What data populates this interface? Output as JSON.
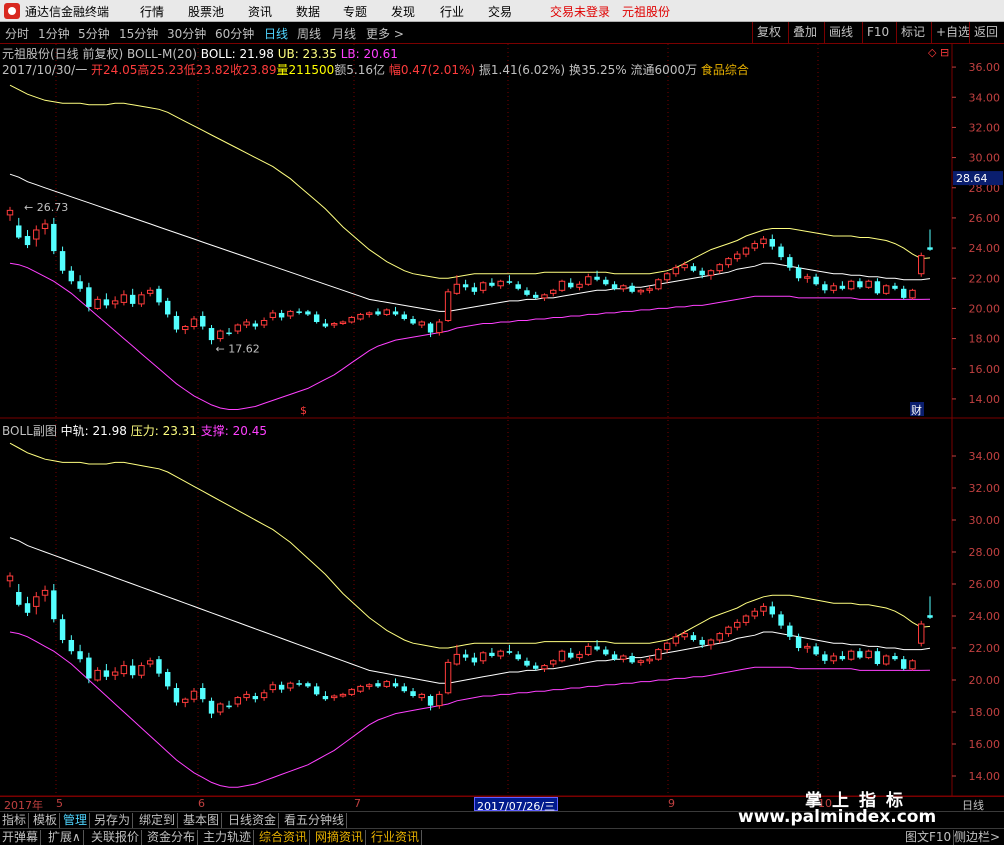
{
  "titlebar": {
    "app_title": "通达信金融终端",
    "menus": [
      "行情",
      "股票池",
      "资讯",
      "数据",
      "专题",
      "发现",
      "行业",
      "交易"
    ],
    "login_status": "交易未登录",
    "stock_name": "元祖股份"
  },
  "periodbar": {
    "tabs": [
      "分时",
      "1分钟",
      "5分钟",
      "15分钟",
      "30分钟",
      "60分钟",
      "日线",
      "周线",
      "月线",
      "更多 >"
    ],
    "active_tab": "日线",
    "tools": [
      "复权",
      "叠加",
      "画线",
      "F10",
      "标记",
      "+自选",
      "返回"
    ]
  },
  "main_panel": {
    "header": "元祖股份(日线 前复权)",
    "indicator": "BOLL-M(20)",
    "boll_label": "BOLL: 21.98",
    "ub_label": "UB: 23.35",
    "lb_label": "LB: 20.61",
    "date": "2017/10/30/一",
    "open": "开24.05",
    "high": "高25.23",
    "low": "低23.82",
    "close": "收23.89",
    "volume": "量211500",
    "amount": "额5.16亿",
    "change": "幅0.47(2.01%)",
    "amplitude": "振1.41(6.02%)",
    "turnover": "换35.25%",
    "float": "流通6000万",
    "sector": "食品综合",
    "high_marker": "26.73",
    "low_marker": "17.62",
    "price_tag": "28.64",
    "money_marker": "$",
    "fin_marker": "财",
    "corner_marker": "◇ ⊟"
  },
  "sub_panel": {
    "label": "BOLL副图",
    "mid": "中轨: 21.98",
    "upper": "压力: 23.31",
    "lower": "支撑: 20.45"
  },
  "axis": {
    "main_ticks": [
      "36.00",
      "34.00",
      "32.00",
      "30.00",
      "28.00",
      "26.00",
      "24.00",
      "22.00",
      "20.00",
      "18.00",
      "16.00",
      "14.00"
    ],
    "sub_ticks": [
      "34.00",
      "32.00",
      "30.00",
      "28.00",
      "26.00",
      "24.00",
      "22.00",
      "20.00",
      "18.00",
      "16.00",
      "14.00"
    ],
    "dates": [
      "2017年",
      "5",
      "6",
      "7",
      "9",
      "10"
    ],
    "cursor_date": "2017/07/26/三",
    "period_label": "日线"
  },
  "bottom_tabs_1": [
    "指标",
    "模板",
    "管理",
    "另存为",
    "绑定到",
    "基本图",
    "日线资金",
    "看五分钟线"
  ],
  "bottom_tabs_1_active": "管理",
  "bottom_tabs_2": [
    "开弹幕",
    "扩展∧",
    "关联报价",
    "资金分布",
    "主力轨迹",
    "综合资讯",
    "网摘资讯",
    "行业资讯"
  ],
  "bottom_right": [
    "图文F10",
    "侧边栏>"
  ],
  "watermark": {
    "cn": "掌上指标",
    "url": "www.palmindex.com"
  },
  "colors": {
    "up": "#ff3c3c",
    "down": "#54ffff",
    "mid_line": "#ffffff",
    "upper_line": "#ffff80",
    "lower_line": "#ff40ff",
    "grid_red": "#7a0000"
  },
  "chart_data": {
    "type": "candlestick",
    "ylim_main": [
      13.0,
      37.0
    ],
    "ylim_sub": [
      13.0,
      35.5
    ],
    "candles": [
      [
        26.2,
        26.73,
        25.8,
        26.5
      ],
      [
        25.5,
        26.0,
        24.6,
        24.7
      ],
      [
        24.8,
        25.2,
        24.0,
        24.2
      ],
      [
        24.6,
        25.5,
        24.1,
        25.2
      ],
      [
        25.3,
        25.9,
        24.9,
        25.6
      ],
      [
        25.6,
        26.0,
        23.6,
        23.8
      ],
      [
        23.8,
        24.1,
        22.3,
        22.5
      ],
      [
        22.5,
        22.8,
        21.6,
        21.8
      ],
      [
        21.8,
        22.2,
        21.1,
        21.3
      ],
      [
        21.4,
        21.7,
        19.8,
        20.1
      ],
      [
        20.0,
        20.8,
        19.9,
        20.6
      ],
      [
        20.6,
        21.0,
        20.0,
        20.2
      ],
      [
        20.3,
        20.8,
        20.0,
        20.5
      ],
      [
        20.4,
        21.2,
        20.2,
        20.9
      ],
      [
        20.9,
        21.3,
        20.1,
        20.3
      ],
      [
        20.3,
        21.1,
        20.1,
        20.9
      ],
      [
        21.0,
        21.4,
        20.8,
        21.2
      ],
      [
        21.3,
        21.5,
        20.2,
        20.4
      ],
      [
        20.5,
        20.7,
        19.4,
        19.6
      ],
      [
        19.5,
        19.8,
        18.4,
        18.6
      ],
      [
        18.6,
        18.9,
        18.3,
        18.8
      ],
      [
        18.8,
        19.5,
        18.6,
        19.3
      ],
      [
        19.5,
        19.8,
        18.6,
        18.8
      ],
      [
        18.7,
        18.9,
        17.62,
        17.9
      ],
      [
        18.0,
        18.6,
        17.8,
        18.5
      ],
      [
        18.4,
        18.7,
        18.2,
        18.3
      ],
      [
        18.5,
        19.0,
        18.3,
        18.9
      ],
      [
        18.9,
        19.3,
        18.7,
        19.1
      ],
      [
        19.0,
        19.2,
        18.6,
        18.8
      ],
      [
        18.9,
        19.4,
        18.7,
        19.2
      ],
      [
        19.4,
        19.9,
        19.2,
        19.7
      ],
      [
        19.7,
        19.9,
        19.2,
        19.4
      ],
      [
        19.5,
        19.9,
        19.3,
        19.8
      ],
      [
        19.8,
        20.0,
        19.6,
        19.7
      ],
      [
        19.8,
        19.9,
        19.5,
        19.6
      ],
      [
        19.6,
        19.8,
        19.0,
        19.1
      ],
      [
        19.0,
        19.3,
        18.7,
        18.8
      ],
      [
        18.9,
        19.1,
        18.7,
        19.0
      ],
      [
        19.0,
        19.2,
        18.9,
        19.1
      ],
      [
        19.1,
        19.5,
        19.0,
        19.4
      ],
      [
        19.3,
        19.7,
        19.2,
        19.6
      ],
      [
        19.6,
        19.8,
        19.4,
        19.7
      ],
      [
        19.8,
        20.0,
        19.5,
        19.6
      ],
      [
        19.6,
        20.0,
        19.5,
        19.9
      ],
      [
        19.8,
        20.1,
        19.5,
        19.6
      ],
      [
        19.6,
        19.8,
        19.2,
        19.3
      ],
      [
        19.3,
        19.5,
        18.9,
        19.0
      ],
      [
        18.9,
        19.2,
        18.7,
        19.1
      ],
      [
        19.0,
        19.1,
        18.1,
        18.4
      ],
      [
        18.4,
        19.3,
        18.2,
        19.1
      ],
      [
        19.2,
        21.3,
        19.1,
        21.1
      ],
      [
        21.0,
        22.2,
        20.9,
        21.6
      ],
      [
        21.6,
        21.9,
        21.2,
        21.4
      ],
      [
        21.4,
        21.7,
        20.9,
        21.1
      ],
      [
        21.2,
        21.8,
        21.0,
        21.7
      ],
      [
        21.7,
        22.0,
        21.4,
        21.5
      ],
      [
        21.5,
        21.9,
        21.3,
        21.8
      ],
      [
        21.8,
        22.2,
        21.6,
        21.7
      ],
      [
        21.6,
        21.8,
        21.2,
        21.3
      ],
      [
        21.2,
        21.4,
        20.8,
        20.9
      ],
      [
        20.9,
        21.1,
        20.6,
        20.7
      ],
      [
        20.7,
        21.0,
        20.5,
        20.9
      ],
      [
        21.0,
        21.3,
        20.8,
        21.2
      ],
      [
        21.2,
        21.9,
        21.1,
        21.8
      ],
      [
        21.7,
        22.0,
        21.3,
        21.4
      ],
      [
        21.4,
        21.8,
        21.2,
        21.6
      ],
      [
        21.6,
        22.3,
        21.5,
        22.1
      ],
      [
        22.1,
        22.5,
        21.8,
        21.9
      ],
      [
        21.9,
        22.1,
        21.5,
        21.6
      ],
      [
        21.6,
        21.8,
        21.2,
        21.3
      ],
      [
        21.3,
        21.6,
        21.1,
        21.5
      ],
      [
        21.5,
        21.7,
        21.0,
        21.1
      ],
      [
        21.1,
        21.3,
        20.9,
        21.2
      ],
      [
        21.2,
        21.5,
        21.0,
        21.3
      ],
      [
        21.3,
        22.0,
        21.2,
        21.9
      ],
      [
        21.9,
        22.4,
        21.7,
        22.3
      ],
      [
        22.3,
        22.9,
        22.1,
        22.7
      ],
      [
        22.7,
        23.1,
        22.5,
        22.9
      ],
      [
        22.8,
        23.0,
        22.4,
        22.5
      ],
      [
        22.5,
        22.7,
        22.0,
        22.2
      ],
      [
        22.2,
        22.6,
        21.9,
        22.5
      ],
      [
        22.5,
        23.0,
        22.3,
        22.9
      ],
      [
        22.9,
        23.4,
        22.7,
        23.3
      ],
      [
        23.3,
        23.8,
        23.1,
        23.6
      ],
      [
        23.6,
        24.1,
        23.4,
        24.0
      ],
      [
        24.0,
        24.5,
        23.8,
        24.3
      ],
      [
        24.3,
        24.8,
        24.0,
        24.6
      ],
      [
        24.6,
        24.9,
        23.9,
        24.1
      ],
      [
        24.1,
        24.3,
        23.2,
        23.4
      ],
      [
        23.4,
        23.6,
        22.5,
        22.7
      ],
      [
        22.7,
        22.9,
        21.8,
        22.0
      ],
      [
        22.0,
        22.3,
        21.7,
        22.1
      ],
      [
        22.1,
        22.3,
        21.5,
        21.6
      ],
      [
        21.6,
        21.8,
        21.0,
        21.2
      ],
      [
        21.2,
        21.7,
        21.0,
        21.5
      ],
      [
        21.5,
        21.8,
        21.2,
        21.3
      ],
      [
        21.3,
        21.9,
        21.2,
        21.8
      ],
      [
        21.8,
        22.0,
        21.3,
        21.4
      ],
      [
        21.4,
        21.9,
        21.3,
        21.8
      ],
      [
        21.8,
        22.0,
        20.9,
        21.0
      ],
      [
        21.0,
        21.6,
        20.9,
        21.5
      ],
      [
        21.5,
        21.7,
        21.2,
        21.3
      ],
      [
        21.3,
        21.5,
        20.6,
        20.7
      ],
      [
        20.7,
        21.3,
        20.6,
        21.2
      ],
      [
        22.3,
        23.7,
        22.1,
        23.5
      ],
      [
        24.05,
        25.23,
        23.82,
        23.89
      ]
    ],
    "upper": [
      34.8,
      34.5,
      34.2,
      34.0,
      33.8,
      33.7,
      33.6,
      33.6,
      33.6,
      33.5,
      33.5,
      33.5,
      33.6,
      33.6,
      33.5,
      33.4,
      33.3,
      33.2,
      33.0,
      32.7,
      32.4,
      32.1,
      31.8,
      31.5,
      31.2,
      30.9,
      30.6,
      30.3,
      30.0,
      29.7,
      29.4,
      29.0,
      28.6,
      28.1,
      27.6,
      27.1,
      26.6,
      26.0,
      25.4,
      24.9,
      24.4,
      23.9,
      23.5,
      23.1,
      22.8,
      22.5,
      22.3,
      22.2,
      22.1,
      22.0,
      22.0,
      22.1,
      22.2,
      22.3,
      22.3,
      22.3,
      22.3,
      22.3,
      22.3,
      22.3,
      22.3,
      22.4,
      22.4,
      22.4,
      22.4,
      22.4,
      22.4,
      22.4,
      22.4,
      22.3,
      22.3,
      22.3,
      22.3,
      22.3,
      22.4,
      22.5,
      22.7,
      23.0,
      23.3,
      23.6,
      23.9,
      24.1,
      24.3,
      24.5,
      24.8,
      25.0,
      25.2,
      25.3,
      25.3,
      25.3,
      25.2,
      25.1,
      25.0,
      24.9,
      24.8,
      24.8,
      24.8,
      24.7,
      24.7,
      24.6,
      24.5,
      24.3,
      24.0,
      23.6,
      23.3,
      23.35
    ],
    "mid": [
      28.9,
      28.7,
      28.4,
      28.2,
      28.0,
      27.8,
      27.6,
      27.4,
      27.2,
      27.0,
      26.8,
      26.6,
      26.4,
      26.2,
      26.0,
      25.8,
      25.6,
      25.4,
      25.2,
      25.0,
      24.8,
      24.6,
      24.4,
      24.2,
      24.0,
      23.8,
      23.6,
      23.4,
      23.2,
      23.0,
      22.8,
      22.6,
      22.4,
      22.2,
      22.0,
      21.8,
      21.6,
      21.4,
      21.2,
      21.0,
      20.8,
      20.6,
      20.5,
      20.4,
      20.3,
      20.2,
      20.1,
      20.0,
      19.9,
      19.8,
      19.8,
      19.9,
      20.0,
      20.1,
      20.2,
      20.3,
      20.4,
      20.5,
      20.5,
      20.6,
      20.6,
      20.7,
      20.7,
      20.8,
      20.9,
      21.0,
      21.1,
      21.2,
      21.2,
      21.3,
      21.3,
      21.4,
      21.4,
      21.5,
      21.6,
      21.7,
      21.8,
      21.9,
      22.0,
      22.1,
      22.2,
      22.3,
      22.4,
      22.6,
      22.7,
      22.8,
      23.0,
      23.0,
      22.9,
      22.8,
      22.7,
      22.6,
      22.5,
      22.4,
      22.3,
      22.3,
      22.2,
      22.2,
      22.1,
      22.1,
      22.0,
      22.0,
      21.9,
      21.9,
      21.9,
      21.98
    ],
    "lower": [
      23.0,
      22.9,
      22.7,
      22.4,
      22.1,
      21.8,
      21.4,
      21.0,
      20.5,
      20.0,
      19.5,
      19.0,
      18.5,
      18.0,
      17.5,
      17.0,
      16.5,
      16.0,
      15.5,
      15.0,
      14.6,
      14.2,
      13.9,
      13.6,
      13.4,
      13.3,
      13.3,
      13.4,
      13.5,
      13.7,
      13.9,
      14.1,
      14.3,
      14.5,
      14.7,
      15.0,
      15.3,
      15.6,
      16.0,
      16.4,
      16.8,
      17.2,
      17.5,
      17.7,
      17.9,
      18.0,
      18.1,
      18.2,
      18.3,
      18.4,
      18.5,
      18.7,
      18.8,
      18.9,
      19.0,
      19.0,
      19.1,
      19.1,
      19.2,
      19.2,
      19.3,
      19.3,
      19.4,
      19.4,
      19.5,
      19.5,
      19.6,
      19.6,
      19.7,
      19.7,
      19.8,
      19.8,
      19.9,
      19.9,
      20.0,
      20.0,
      20.1,
      20.1,
      20.2,
      20.2,
      20.3,
      20.4,
      20.5,
      20.6,
      20.7,
      20.8,
      20.8,
      20.8,
      20.8,
      20.8,
      20.7,
      20.7,
      20.7,
      20.7,
      20.7,
      20.7,
      20.7,
      20.6,
      20.6,
      20.6,
      20.6,
      20.6,
      20.6,
      20.6,
      20.6,
      20.61
    ]
  }
}
